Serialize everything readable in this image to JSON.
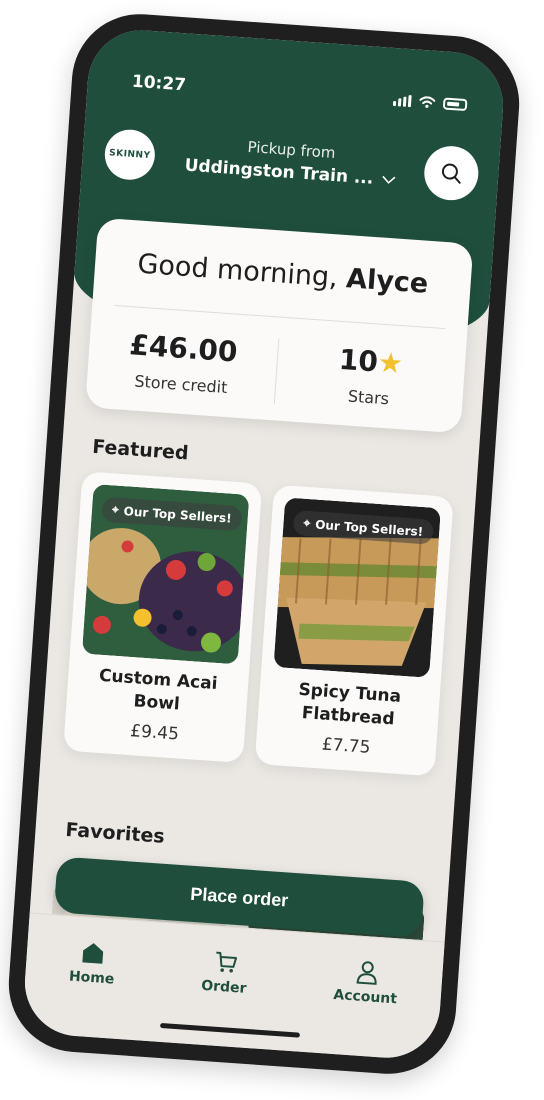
{
  "status_bar": {
    "time": "10:27"
  },
  "header": {
    "logo_text": "SKINNY",
    "pickup_label": "Pickup from",
    "pickup_store": "Uddingston Train ...",
    "search_icon": "search-icon"
  },
  "greeting": {
    "prefix": "Good morning,",
    "name": "Alyce",
    "store_credit_value": "£46.00",
    "store_credit_label": "Store credit",
    "stars_value": "10",
    "stars_label": "Stars"
  },
  "featured": {
    "title": "Featured",
    "items": [
      {
        "badge": "Our Top Sellers!",
        "name": "Custom Acai Bowl",
        "price": "£9.45"
      },
      {
        "badge": "Our Top Sellers!",
        "name": "Spicy Tuna Flatbread",
        "price": "£7.75"
      }
    ]
  },
  "favorites": {
    "title": "Favorites"
  },
  "actions": {
    "place_order": "Place order"
  },
  "tabs": [
    {
      "label": "Home",
      "icon": "home-icon"
    },
    {
      "label": "Order",
      "icon": "cart-icon"
    },
    {
      "label": "Account",
      "icon": "user-icon"
    }
  ],
  "colors": {
    "brand_green": "#1f4f3c",
    "background": "#ebe8e4",
    "star": "#f2c12e"
  }
}
